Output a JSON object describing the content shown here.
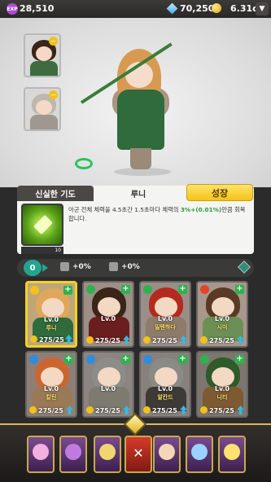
{
  "topbar": {
    "exp_label": "EXP",
    "exp_value": "28,510",
    "gems": "70,250",
    "gold": "6.31d"
  },
  "hero_name": "루니",
  "skill_tab_label": "신실한 기도",
  "grow_button_label": "성장",
  "skill": {
    "level_label": "",
    "level_value": "10",
    "desc_part1": "아군 전체 체력을 4.5초간 1.5초마다 체력의 ",
    "desc_highlight": "3%+(0.01%)",
    "desc_part2": "만큼 회복합니다."
  },
  "stats": {
    "level": "0",
    "attack_bonus": "+0%",
    "defense_bonus": "+0%"
  },
  "cards": [
    {
      "name": "루니",
      "lv": "Lv.0",
      "count": "275/25",
      "elem": "sun",
      "elem_color": "#f2c21b",
      "hair": "#e0a65a",
      "clothes": "#2f6b3d",
      "bg": "#bda77a",
      "selected": true
    },
    {
      "name": "",
      "lv": "Lv.0",
      "count": "275/25",
      "elem": "leaf",
      "elem_color": "#2fb24e",
      "hair": "#3b2418",
      "clothes": "#6b1e1e",
      "bg": "#9d8e86",
      "selected": false
    },
    {
      "name": "밀텐하다",
      "lv": "Lv.0",
      "count": "275/25",
      "elem": "leaf",
      "elem_color": "#2fb24e",
      "hair": "#b52a1f",
      "clothes": "#8f7b6a",
      "bg": "#9a8e88",
      "selected": false
    },
    {
      "name": "시미",
      "lv": "Lv.0",
      "count": "275/25",
      "elem": "fire",
      "elem_color": "#e0442b",
      "hair": "#5b3a25",
      "clothes": "#6b8f55",
      "bg": "#a8978c",
      "selected": false
    },
    {
      "name": "칼틴",
      "lv": "Lv.0",
      "count": "275/25",
      "elem": "water",
      "elem_color": "#2f8de0",
      "hair": "#cc6630",
      "clothes": "#9a7a56",
      "bg": "#8d7f76",
      "selected": false
    },
    {
      "name": "",
      "lv": "Lv.0",
      "count": "275/25",
      "elem": "water",
      "elem_color": "#2f8de0",
      "hair": "#8c8c88",
      "clothes": "#7d7a6f",
      "bg": "#8b8480",
      "selected": false
    },
    {
      "name": "알칸드",
      "lv": "Lv.0",
      "count": "275/25",
      "elem": "water",
      "elem_color": "#2f8de0",
      "hair": "#8a8a86",
      "clothes": "#3e3a37",
      "bg": "#87807c",
      "selected": false
    },
    {
      "name": "니티",
      "lv": "Lv.0",
      "count": "275/25",
      "elem": "leaf",
      "elem_color": "#2fb24e",
      "hair": "#2f5a2a",
      "clothes": "#7d5a32",
      "bg": "#7d7670",
      "selected": false
    }
  ],
  "portraits": [
    {
      "name": "portrait-top",
      "hair": "#3b2418",
      "body": "#3f6c3f"
    },
    {
      "name": "portrait-bottom",
      "hair": "#bfb7ae",
      "body": "#9f9790"
    }
  ],
  "nav": [
    {
      "name": "nav-summon",
      "color": "#f1b0e0"
    },
    {
      "name": "nav-shield",
      "color": "#c07be0"
    },
    {
      "name": "nav-sword",
      "color": "#f1d570"
    },
    {
      "name": "nav-close",
      "color": "#ffffff"
    },
    {
      "name": "nav-heroes",
      "color": "#f3d6b5"
    },
    {
      "name": "nav-magic",
      "color": "#9ad3ff"
    },
    {
      "name": "nav-treasure",
      "color": "#ffe170"
    }
  ]
}
